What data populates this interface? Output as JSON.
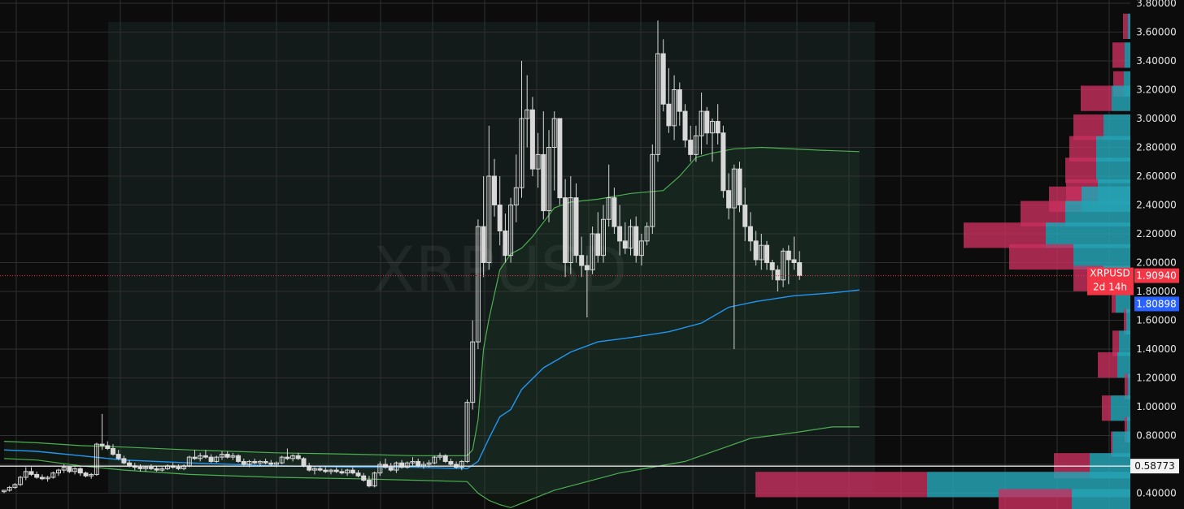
{
  "chart_data": {
    "type": "candlestick",
    "symbol_watermark": "XRPUSD",
    "ylim": [
      0.36,
      3.8
    ],
    "y_ticks": [
      "3.80000",
      "3.60000",
      "3.40000",
      "3.20000",
      "3.00000",
      "2.80000",
      "2.60000",
      "2.40000",
      "2.20000",
      "2.00000",
      "1.80000",
      "1.60000",
      "1.40000",
      "1.20000",
      "1.00000",
      "0.80000",
      "0.60000",
      "0.40000"
    ],
    "last_price": 1.9094,
    "last_price_label": "1.90940",
    "price_tag_symbol": "XRPUSD",
    "countdown": "2d 14h",
    "vwap_value": 1.80898,
    "vwap_label": "1.80898",
    "hline_value": 0.58773,
    "hline_label": "0.58773",
    "colors": {
      "background": "#0c0c0c",
      "grid": "#2f2f2f",
      "candle": "#d8d8d8",
      "band": "#4caf50",
      "vwap": "#2196f3",
      "volume_up": "#26a2b4",
      "volume_down": "#c8305f",
      "price_tag": "#f23645",
      "vwap_tag": "#2962ff"
    },
    "candles": [
      [
        0.41,
        0.42,
        0.4,
        0.42
      ],
      [
        0.42,
        0.45,
        0.41,
        0.44
      ],
      [
        0.44,
        0.47,
        0.43,
        0.46
      ],
      [
        0.46,
        0.52,
        0.45,
        0.51
      ],
      [
        0.51,
        0.58,
        0.49,
        0.55
      ],
      [
        0.55,
        0.58,
        0.52,
        0.53
      ],
      [
        0.53,
        0.55,
        0.5,
        0.51
      ],
      [
        0.51,
        0.53,
        0.49,
        0.5
      ],
      [
        0.5,
        0.52,
        0.48,
        0.51
      ],
      [
        0.51,
        0.55,
        0.5,
        0.54
      ],
      [
        0.54,
        0.57,
        0.52,
        0.56
      ],
      [
        0.56,
        0.6,
        0.54,
        0.58
      ],
      [
        0.58,
        0.59,
        0.54,
        0.55
      ],
      [
        0.55,
        0.58,
        0.53,
        0.57
      ],
      [
        0.57,
        0.58,
        0.52,
        0.54
      ],
      [
        0.54,
        0.55,
        0.51,
        0.52
      ],
      [
        0.52,
        0.54,
        0.5,
        0.53
      ],
      [
        0.53,
        0.75,
        0.52,
        0.74
      ],
      [
        0.74,
        0.95,
        0.7,
        0.73
      ],
      [
        0.73,
        0.76,
        0.7,
        0.71
      ],
      [
        0.71,
        0.74,
        0.66,
        0.67
      ],
      [
        0.67,
        0.7,
        0.63,
        0.64
      ],
      [
        0.64,
        0.66,
        0.6,
        0.61
      ],
      [
        0.61,
        0.63,
        0.58,
        0.59
      ],
      [
        0.59,
        0.61,
        0.56,
        0.58
      ],
      [
        0.58,
        0.6,
        0.55,
        0.57
      ],
      [
        0.57,
        0.59,
        0.55,
        0.58
      ],
      [
        0.58,
        0.6,
        0.56,
        0.57
      ],
      [
        0.57,
        0.59,
        0.55,
        0.56
      ],
      [
        0.56,
        0.58,
        0.55,
        0.57
      ],
      [
        0.57,
        0.6,
        0.56,
        0.59
      ],
      [
        0.59,
        0.61,
        0.57,
        0.58
      ],
      [
        0.58,
        0.6,
        0.56,
        0.57
      ],
      [
        0.57,
        0.6,
        0.56,
        0.59
      ],
      [
        0.59,
        0.66,
        0.58,
        0.65
      ],
      [
        0.65,
        0.7,
        0.63,
        0.64
      ],
      [
        0.64,
        0.68,
        0.62,
        0.66
      ],
      [
        0.66,
        0.7,
        0.64,
        0.65
      ],
      [
        0.65,
        0.67,
        0.61,
        0.62
      ],
      [
        0.62,
        0.66,
        0.61,
        0.65
      ],
      [
        0.65,
        0.69,
        0.63,
        0.67
      ],
      [
        0.67,
        0.69,
        0.64,
        0.65
      ],
      [
        0.65,
        0.68,
        0.63,
        0.66
      ],
      [
        0.66,
        0.67,
        0.61,
        0.62
      ],
      [
        0.62,
        0.64,
        0.59,
        0.6
      ],
      [
        0.6,
        0.63,
        0.58,
        0.62
      ],
      [
        0.62,
        0.64,
        0.6,
        0.61
      ],
      [
        0.61,
        0.63,
        0.59,
        0.62
      ],
      [
        0.62,
        0.64,
        0.6,
        0.61
      ],
      [
        0.61,
        0.63,
        0.59,
        0.6
      ],
      [
        0.6,
        0.62,
        0.58,
        0.61
      ],
      [
        0.61,
        0.66,
        0.6,
        0.65
      ],
      [
        0.65,
        0.71,
        0.63,
        0.64
      ],
      [
        0.64,
        0.67,
        0.62,
        0.66
      ],
      [
        0.66,
        0.68,
        0.63,
        0.64
      ],
      [
        0.64,
        0.65,
        0.58,
        0.59
      ],
      [
        0.59,
        0.61,
        0.55,
        0.56
      ],
      [
        0.56,
        0.58,
        0.53,
        0.57
      ],
      [
        0.57,
        0.59,
        0.55,
        0.56
      ],
      [
        0.56,
        0.58,
        0.54,
        0.55
      ],
      [
        0.55,
        0.57,
        0.53,
        0.56
      ],
      [
        0.56,
        0.58,
        0.54,
        0.55
      ],
      [
        0.55,
        0.57,
        0.53,
        0.54
      ],
      [
        0.54,
        0.57,
        0.52,
        0.56
      ],
      [
        0.56,
        0.58,
        0.53,
        0.54
      ],
      [
        0.54,
        0.56,
        0.51,
        0.52
      ],
      [
        0.52,
        0.54,
        0.48,
        0.49
      ],
      [
        0.49,
        0.52,
        0.44,
        0.45
      ],
      [
        0.45,
        0.55,
        0.44,
        0.54
      ],
      [
        0.54,
        0.62,
        0.52,
        0.6
      ],
      [
        0.6,
        0.64,
        0.57,
        0.58
      ],
      [
        0.58,
        0.61,
        0.55,
        0.56
      ],
      [
        0.56,
        0.62,
        0.54,
        0.61
      ],
      [
        0.61,
        0.63,
        0.57,
        0.58
      ],
      [
        0.58,
        0.62,
        0.57,
        0.61
      ],
      [
        0.61,
        0.65,
        0.59,
        0.62
      ],
      [
        0.62,
        0.64,
        0.58,
        0.59
      ],
      [
        0.59,
        0.62,
        0.57,
        0.6
      ],
      [
        0.6,
        0.63,
        0.58,
        0.61
      ],
      [
        0.61,
        0.66,
        0.6,
        0.65
      ],
      [
        0.65,
        0.68,
        0.63,
        0.66
      ],
      [
        0.66,
        0.67,
        0.61,
        0.62
      ],
      [
        0.62,
        0.64,
        0.59,
        0.6
      ],
      [
        0.6,
        0.62,
        0.57,
        0.58
      ],
      [
        0.58,
        0.63,
        0.56,
        0.62
      ],
      [
        0.62,
        1.05,
        0.61,
        1.03
      ],
      [
        1.03,
        1.6,
        0.98,
        1.45
      ],
      [
        1.45,
        2.3,
        1.4,
        2.25
      ],
      [
        2.25,
        2.6,
        1.9,
        2.0
      ],
      [
        2.0,
        2.95,
        1.95,
        2.6
      ],
      [
        2.6,
        2.72,
        2.32,
        2.4
      ],
      [
        2.4,
        2.6,
        2.12,
        2.22
      ],
      [
        2.22,
        2.34,
        2.0,
        2.05
      ],
      [
        2.05,
        2.45,
        2.0,
        2.4
      ],
      [
        2.4,
        2.75,
        2.28,
        2.52
      ],
      [
        2.52,
        3.4,
        2.45,
        3.0
      ],
      [
        3.0,
        3.3,
        2.8,
        3.06
      ],
      [
        3.06,
        3.15,
        2.6,
        2.65
      ],
      [
        2.65,
        2.9,
        2.52,
        2.75
      ],
      [
        2.75,
        3.05,
        2.3,
        2.36
      ],
      [
        2.36,
        2.92,
        2.28,
        2.8
      ],
      [
        2.8,
        3.05,
        2.5,
        3.0
      ],
      [
        3.0,
        3.0,
        2.4,
        2.45
      ],
      [
        2.45,
        2.58,
        1.9,
        2.0
      ],
      [
        2.0,
        2.6,
        1.92,
        2.45
      ],
      [
        2.45,
        2.55,
        2.0,
        2.05
      ],
      [
        2.05,
        2.18,
        1.9,
        1.98
      ],
      [
        1.98,
        2.05,
        1.62,
        1.95
      ],
      [
        1.95,
        2.25,
        1.92,
        2.2
      ],
      [
        2.2,
        2.35,
        2.0,
        2.05
      ],
      [
        2.05,
        2.4,
        2.0,
        2.3
      ],
      [
        2.3,
        2.68,
        2.25,
        2.45
      ],
      [
        2.45,
        2.52,
        2.2,
        2.25
      ],
      [
        2.25,
        2.4,
        2.05,
        2.15
      ],
      [
        2.15,
        2.28,
        2.06,
        2.1
      ],
      [
        2.1,
        2.3,
        2.05,
        2.25
      ],
      [
        2.25,
        2.32,
        2.0,
        2.05
      ],
      [
        2.05,
        2.2,
        1.98,
        2.15
      ],
      [
        2.15,
        2.28,
        2.12,
        2.25
      ],
      [
        2.25,
        2.82,
        2.2,
        2.75
      ],
      [
        2.75,
        3.68,
        2.7,
        3.45
      ],
      [
        3.45,
        3.55,
        3.05,
        3.1
      ],
      [
        3.1,
        3.35,
        2.9,
        2.95
      ],
      [
        2.95,
        3.3,
        2.85,
        3.2
      ],
      [
        3.2,
        3.25,
        2.95,
        3.05
      ],
      [
        3.05,
        3.1,
        2.8,
        2.85
      ],
      [
        2.85,
        2.95,
        2.7,
        2.75
      ],
      [
        2.75,
        2.95,
        2.7,
        2.88
      ],
      [
        2.88,
        3.18,
        2.75,
        3.05
      ],
      [
        3.05,
        3.08,
        2.82,
        2.9
      ],
      [
        2.9,
        3.0,
        2.7,
        2.98
      ],
      [
        2.98,
        3.1,
        2.82,
        2.9
      ],
      [
        2.9,
        2.95,
        2.45,
        2.5
      ],
      [
        2.5,
        2.62,
        2.3,
        2.38
      ],
      [
        2.38,
        2.68,
        1.4,
        2.65
      ],
      [
        2.65,
        2.7,
        2.35,
        2.4
      ],
      [
        2.4,
        2.52,
        2.15,
        2.25
      ],
      [
        2.25,
        2.35,
        2.08,
        2.15
      ],
      [
        2.15,
        2.22,
        1.98,
        2.02
      ],
      [
        2.02,
        2.2,
        1.95,
        2.12
      ],
      [
        2.12,
        2.15,
        1.95,
        2.0
      ],
      [
        2.0,
        2.02,
        1.88,
        1.95
      ],
      [
        1.95,
        1.98,
        1.8,
        1.88
      ],
      [
        1.88,
        2.1,
        1.83,
        2.08
      ],
      [
        2.08,
        2.12,
        1.85,
        2.02
      ],
      [
        2.02,
        2.18,
        1.95,
        2.0
      ],
      [
        2.0,
        2.08,
        1.88,
        1.91
      ]
    ],
    "volume_profile": [
      {
        "price": 3.64,
        "up": 3,
        "down": 6
      },
      {
        "price": 3.44,
        "up": 7,
        "down": 15
      },
      {
        "price": 3.24,
        "up": 8,
        "down": 13
      },
      {
        "price": 3.14,
        "up": 23,
        "down": 38
      },
      {
        "price": 2.94,
        "up": 33,
        "down": 37
      },
      {
        "price": 2.79,
        "up": 42,
        "down": 33
      },
      {
        "price": 2.64,
        "up": 42,
        "down": 38
      },
      {
        "price": 2.49,
        "up": 40,
        "down": 39
      },
      {
        "price": 2.44,
        "up": 60,
        "down": 40
      },
      {
        "price": 2.34,
        "up": 80,
        "down": 55
      },
      {
        "price": 2.19,
        "up": 104,
        "down": 101
      },
      {
        "price": 2.04,
        "up": 70,
        "down": 79
      },
      {
        "price": 1.89,
        "up": 33,
        "down": 37
      },
      {
        "price": 1.74,
        "up": 18,
        "down": 5
      },
      {
        "price": 1.59,
        "up": 5,
        "down": 3
      },
      {
        "price": 1.44,
        "up": 14,
        "down": 8
      },
      {
        "price": 1.29,
        "up": 16,
        "down": 24
      },
      {
        "price": 1.14,
        "up": 3,
        "down": 4
      },
      {
        "price": 0.99,
        "up": 24,
        "down": 11
      },
      {
        "price": 0.84,
        "up": 4,
        "down": 3
      },
      {
        "price": 0.74,
        "up": 22,
        "down": 2
      },
      {
        "price": 0.59,
        "up": 50,
        "down": 44
      },
      {
        "price": 0.46,
        "up": 250,
        "down": 211
      },
      {
        "price": 0.34,
        "up": 72,
        "down": 90
      }
    ],
    "vwap_line": [
      [
        0,
        0.7
      ],
      [
        6,
        0.69
      ],
      [
        14,
        0.66
      ],
      [
        22,
        0.63
      ],
      [
        34,
        0.61
      ],
      [
        50,
        0.59
      ],
      [
        65,
        0.58
      ],
      [
        75,
        0.58
      ],
      [
        85,
        0.57
      ],
      [
        87,
        0.62
      ],
      [
        89,
        0.78
      ],
      [
        91,
        0.93
      ],
      [
        93,
        0.98
      ],
      [
        95,
        1.12
      ],
      [
        99,
        1.27
      ],
      [
        104,
        1.38
      ],
      [
        109,
        1.45
      ],
      [
        115,
        1.48
      ],
      [
        122,
        1.52
      ],
      [
        128,
        1.58
      ],
      [
        133,
        1.69
      ],
      [
        138,
        1.73
      ],
      [
        145,
        1.77
      ],
      [
        152,
        1.79
      ],
      [
        157,
        1.81
      ]
    ],
    "upper_band": [
      [
        0,
        0.76
      ],
      [
        6,
        0.75
      ],
      [
        14,
        0.73
      ],
      [
        22,
        0.72
      ],
      [
        34,
        0.7
      ],
      [
        50,
        0.68
      ],
      [
        65,
        0.67
      ],
      [
        75,
        0.66
      ],
      [
        85,
        0.66
      ],
      [
        86,
        0.7
      ],
      [
        87,
        0.91
      ],
      [
        88,
        1.4
      ],
      [
        89,
        1.61
      ],
      [
        91,
        1.95
      ],
      [
        93,
        2.06
      ],
      [
        95,
        2.1
      ],
      [
        97,
        2.18
      ],
      [
        99,
        2.28
      ],
      [
        101,
        2.38
      ],
      [
        104,
        2.42
      ],
      [
        109,
        2.44
      ],
      [
        115,
        2.48
      ],
      [
        121,
        2.5
      ],
      [
        124,
        2.6
      ],
      [
        127,
        2.73
      ],
      [
        130,
        2.76
      ],
      [
        134,
        2.79
      ],
      [
        139,
        2.8
      ],
      [
        150,
        2.78
      ],
      [
        157,
        2.77
      ]
    ],
    "lower_band": [
      [
        0,
        0.64
      ],
      [
        6,
        0.63
      ],
      [
        14,
        0.59
      ],
      [
        22,
        0.56
      ],
      [
        34,
        0.53
      ],
      [
        50,
        0.51
      ],
      [
        65,
        0.5
      ],
      [
        75,
        0.49
      ],
      [
        85,
        0.48
      ],
      [
        87,
        0.4
      ],
      [
        89,
        0.35
      ],
      [
        91,
        0.32
      ],
      [
        93,
        0.3
      ],
      [
        97,
        0.36
      ],
      [
        101,
        0.42
      ],
      [
        107,
        0.48
      ],
      [
        113,
        0.54
      ],
      [
        119,
        0.58
      ],
      [
        125,
        0.62
      ],
      [
        131,
        0.7
      ],
      [
        137,
        0.78
      ],
      [
        145,
        0.82
      ],
      [
        152,
        0.86
      ],
      [
        157,
        0.86
      ]
    ]
  }
}
